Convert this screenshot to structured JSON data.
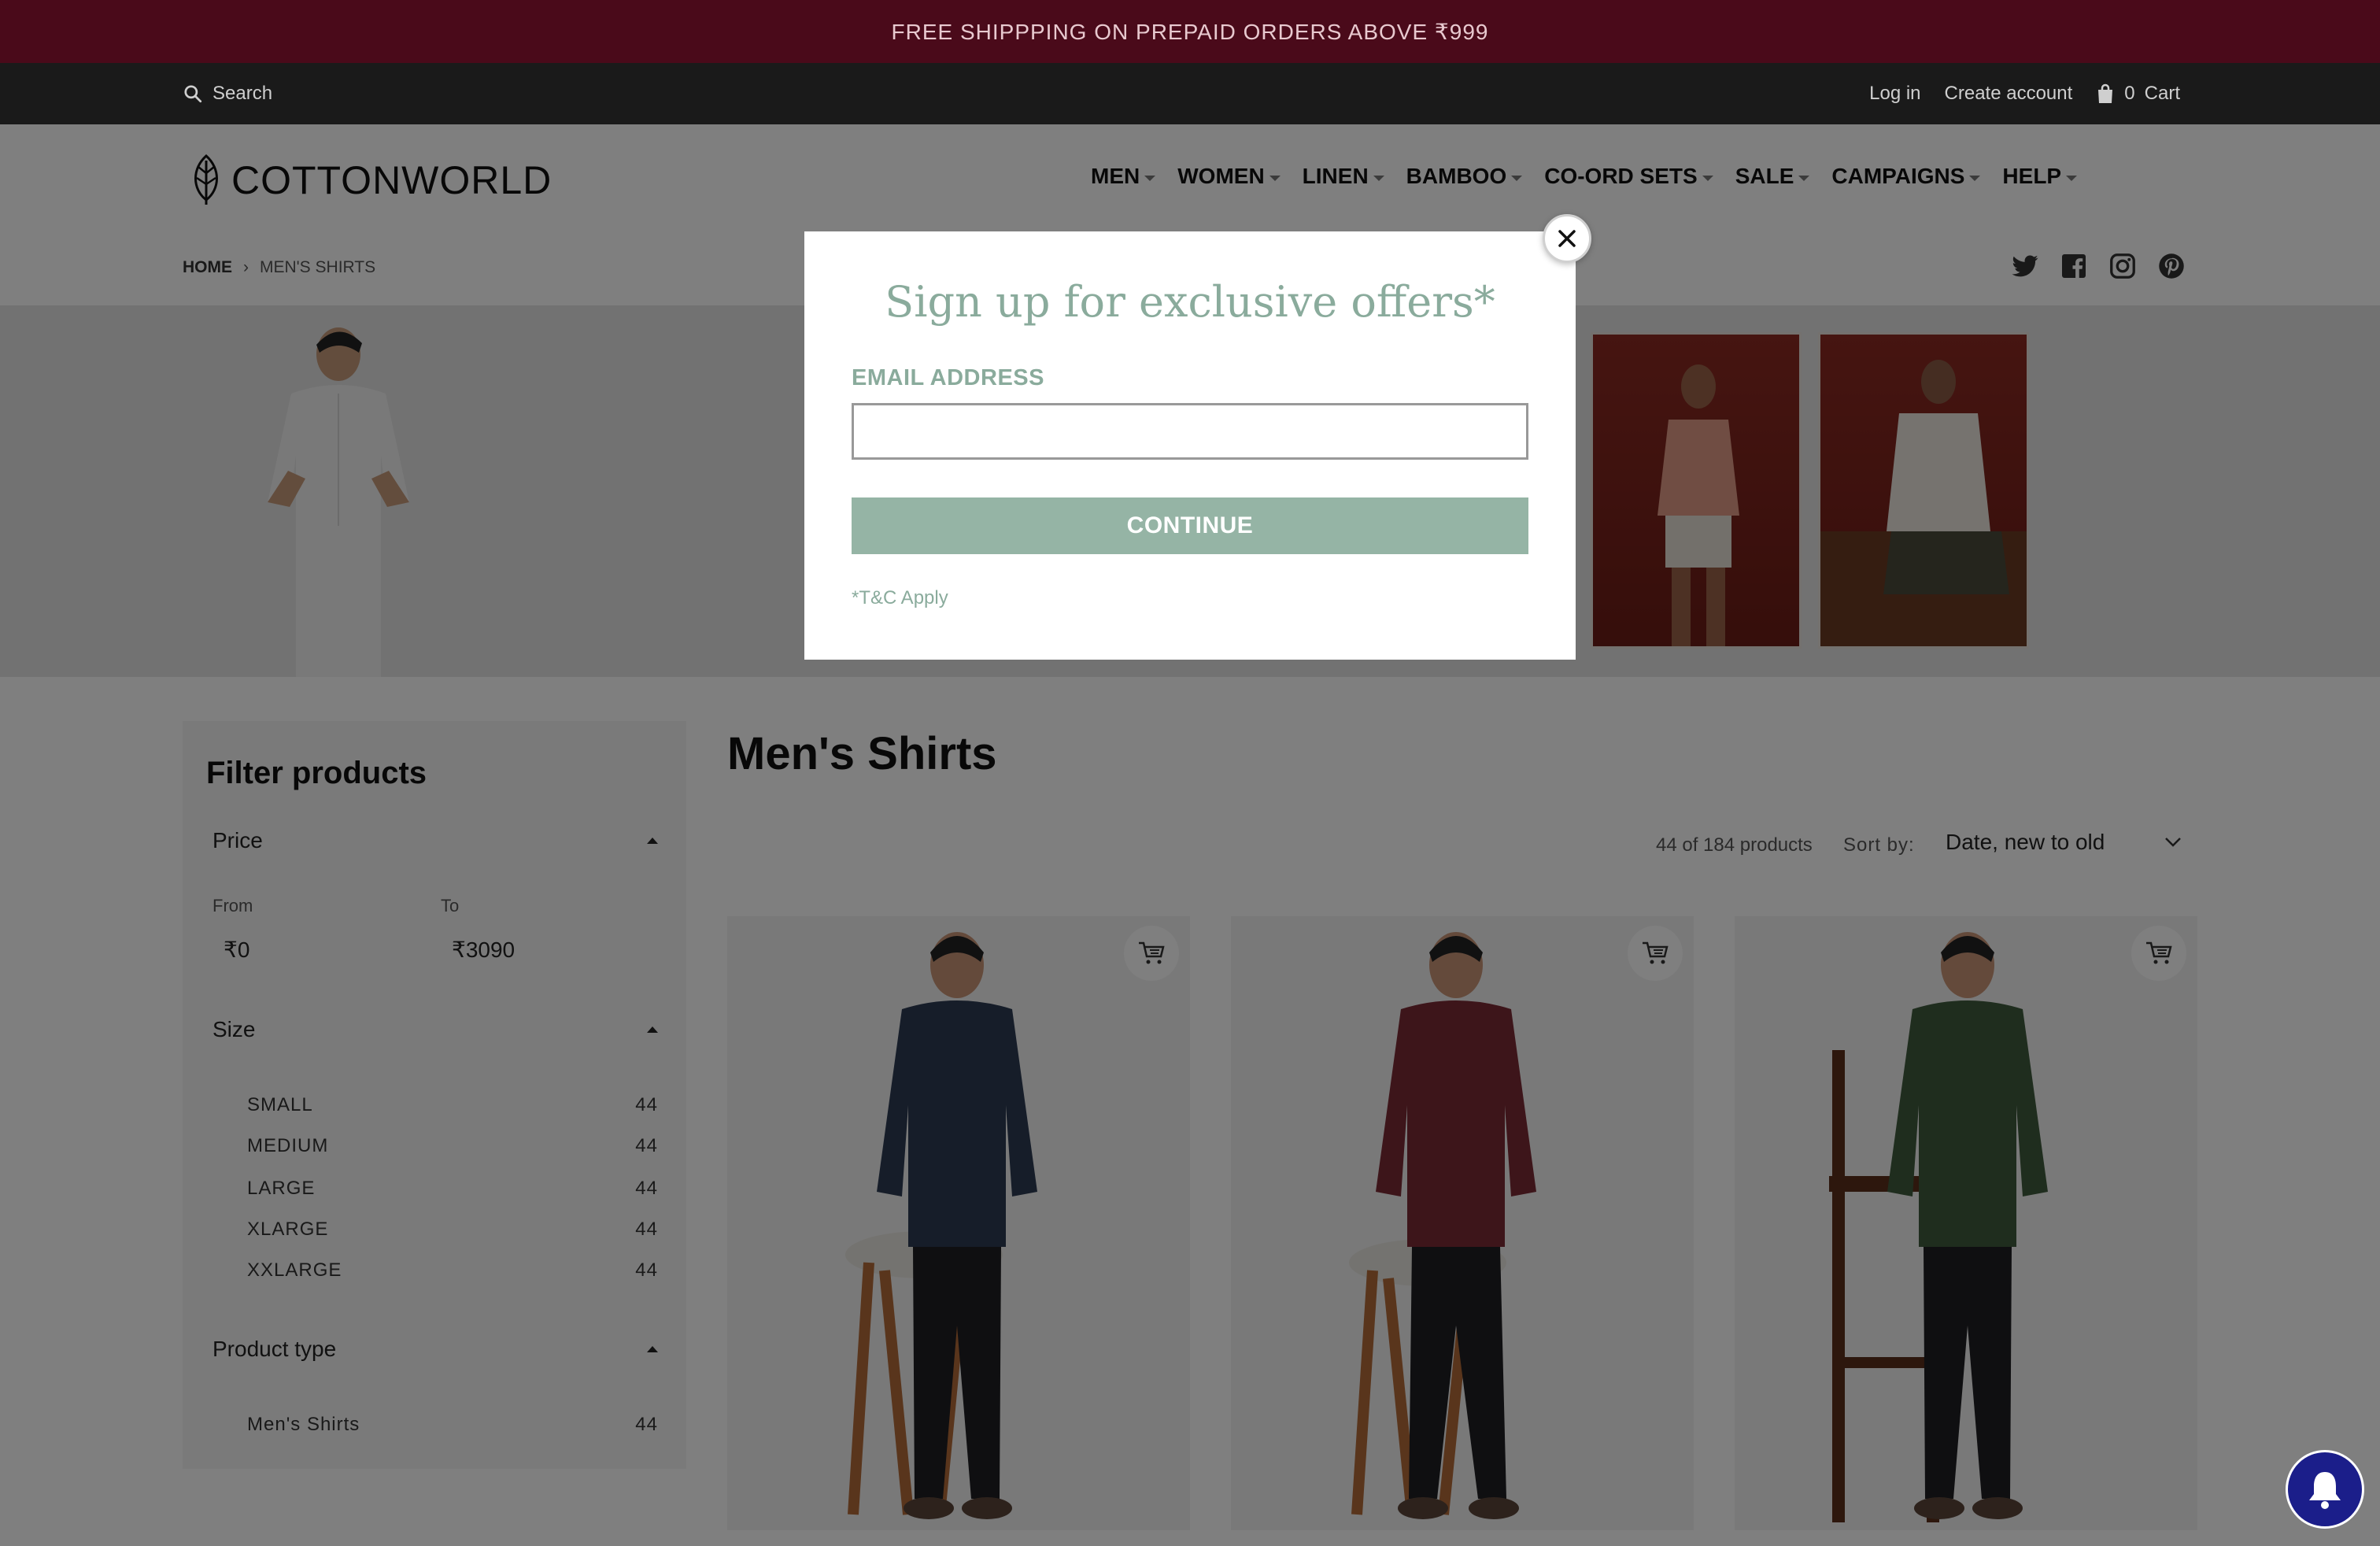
{
  "announcement": {
    "text": "FREE SHIPPPING ON PREPAID ORDERS ABOVE ₹999"
  },
  "utility": {
    "search_label": "Search",
    "login_label": "Log in",
    "create_account_label": "Create account",
    "cart_count": "0",
    "cart_label": "Cart"
  },
  "header": {
    "logo_text": "COTTONWORLD",
    "nav": [
      {
        "label": "MEN"
      },
      {
        "label": "WOMEN"
      },
      {
        "label": "LINEN"
      },
      {
        "label": "BAMBOO"
      },
      {
        "label": "CO-ORD SETS"
      },
      {
        "label": "SALE"
      },
      {
        "label": "CAMPAIGNS"
      },
      {
        "label": "HELP"
      }
    ],
    "breadcrumb": {
      "home": "HOME",
      "separator": "›",
      "current": "MEN'S SHIRTS"
    },
    "social_icons": [
      "twitter-icon",
      "facebook-icon",
      "instagram-icon",
      "pinterest-icon"
    ]
  },
  "filter": {
    "title": "Filter products",
    "price": {
      "heading": "Price",
      "from_label": "From",
      "to_label": "To",
      "from_value": "₹0",
      "to_value": "₹3090"
    },
    "size": {
      "heading": "Size",
      "options": [
        {
          "label": "SMALL",
          "count": "44"
        },
        {
          "label": "MEDIUM",
          "count": "44"
        },
        {
          "label": "LARGE",
          "count": "44"
        },
        {
          "label": "XLARGE",
          "count": "44"
        },
        {
          "label": "XXLARGE",
          "count": "44"
        }
      ]
    },
    "product_type": {
      "heading": "Product type",
      "options": [
        {
          "label": "Men's Shirts",
          "count": "44"
        }
      ]
    }
  },
  "collection": {
    "title": "Men's Shirts",
    "result_count": "44 of 184 products",
    "sort_label": "Sort by:",
    "sort_value": "Date, new to old"
  },
  "products": [
    {
      "shirt_color": "#2c3a52"
    },
    {
      "shirt_color": "#7a2a35"
    },
    {
      "shirt_color": "#3f5a3c"
    }
  ],
  "modal": {
    "title": "Sign up for exclusive offers*",
    "email_label": "EMAIL ADDRESS",
    "email_value": "",
    "continue_label": "CONTINUE",
    "terms": "*T&C Apply"
  },
  "colors": {
    "announcement_bg": "#4a0a1a",
    "utility_bg": "#1a1a1a",
    "modal_accent": "#8aab9c",
    "continue_bg": "#95b4a5",
    "bell_bg": "#1b1e8a"
  }
}
